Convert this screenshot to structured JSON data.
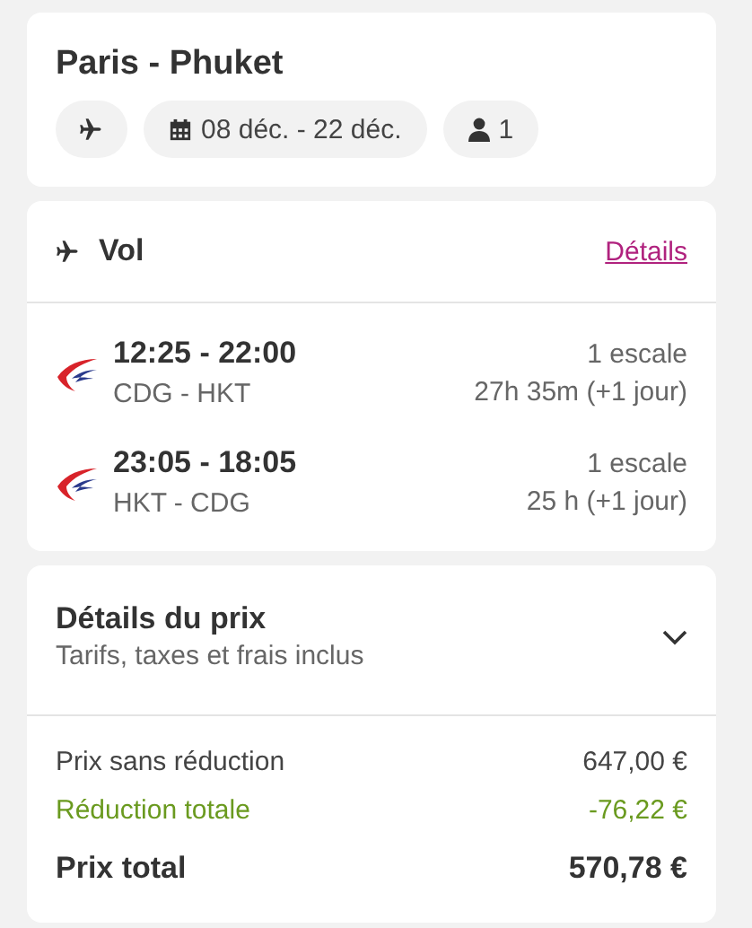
{
  "trip": {
    "title": "Paris - Phuket",
    "chips": [
      {
        "kind": "plane"
      },
      {
        "kind": "calendar",
        "text": "08 déc. - 22 déc."
      },
      {
        "kind": "person",
        "text": "1"
      }
    ]
  },
  "flight": {
    "title": "Vol",
    "link": "Détails",
    "legs": [
      {
        "times": "12:25 - 22:00",
        "route": "CDG - HKT",
        "stops": "1 escale",
        "duration": "27h 35m (+1 jour)"
      },
      {
        "times": "23:05 - 18:05",
        "route": "HKT - CDG",
        "stops": "1 escale",
        "duration": "25 h (+1 jour)"
      }
    ]
  },
  "price": {
    "title": "Détails du prix",
    "subtitle": "Tarifs, taxes et frais inclus",
    "expanded": false,
    "rows": [
      {
        "kind": "normal",
        "label": "Prix sans réduction",
        "value": "647,00 €"
      },
      {
        "kind": "discount",
        "label": "Réduction totale",
        "value": "-76,22 €"
      },
      {
        "kind": "total",
        "label": "Prix total",
        "value": "570,78 €"
      }
    ]
  }
}
